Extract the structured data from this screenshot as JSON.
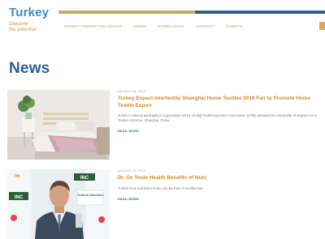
{
  "header": {
    "logo_main": "Turkey",
    "logo_tagline": "Discover\nthe potential",
    "nav": [
      "TURKEY PROMOTION GROUP",
      "NEWS",
      "DOWNLOADS",
      "CONTACT",
      "EVENTS"
    ]
  },
  "main": {
    "title": "News",
    "articles": [
      {
        "date": "AUGUST 28, 2019",
        "title": "Turkey Expect Intertextile Shanghai Home Textiles 2019 Fair to Promote Home Textile Export",
        "excerpt": "Turkey's national participation organization led by Uludağ Textile Exporters' Association (UTIB) attended the Intertextile Shanghai Home Textiles 2019 fair, Shanghai, China.",
        "read_more": "READ MORE"
      },
      {
        "date": "AUGUST 19, 2019",
        "title": "Dr. Oz Touts Health Benefits of Nuts",
        "excerpt": "Turkish Nuts and Dried Fruits Can Be Part of Healthy Diet",
        "read_more": "READ MORE",
        "image_texts": [
          "INC",
          "INC",
          "Turkish Hazelnut",
          "7th"
        ]
      }
    ]
  },
  "colors": {
    "brand_blue": "#2d5e93",
    "logo_blue": "#3a8fc9",
    "gold": "#c8a96b",
    "title_orange": "#d08a2c"
  }
}
